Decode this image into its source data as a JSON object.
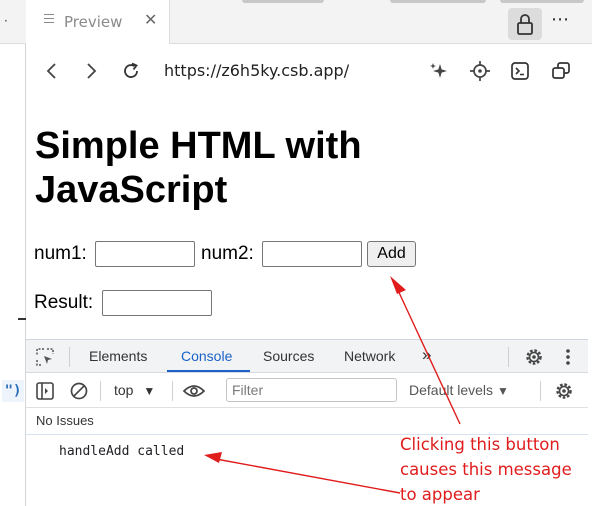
{
  "editor": {
    "paren": "\")"
  },
  "tab": {
    "label": "Preview",
    "close": "✕"
  },
  "toolbar": {
    "url": "https://z6h5ky.csb.app/",
    "more": "⋯"
  },
  "page": {
    "heading": "Simple HTML with JavaScript",
    "num1_label": "num1:",
    "num1_value": "",
    "num2_label": "num2:",
    "num2_value": "",
    "add_label": "Add",
    "result_label": "Result:",
    "result_value": ""
  },
  "devtools": {
    "tabs": [
      "Elements",
      "Console",
      "Sources",
      "Network"
    ],
    "active_tab": "Console",
    "overflow": "»",
    "context": "top",
    "filter_placeholder": "Filter",
    "levels": "Default levels",
    "issues": "No Issues",
    "log": "handleAdd called",
    "accent": "#1a62c9"
  },
  "annotation": {
    "line1": "Clicking this button",
    "line2": "causes this message",
    "line3": "to appear",
    "color": "#e01c1c"
  },
  "icons": [
    "back-icon",
    "forward-icon",
    "reload-icon",
    "sparkle-icon",
    "crosshair-icon",
    "terminal-icon",
    "copy-window-icon",
    "lock-icon",
    "inspect-icon",
    "sidebar-icon",
    "clear-icon",
    "eye-icon",
    "gear-icon"
  ]
}
